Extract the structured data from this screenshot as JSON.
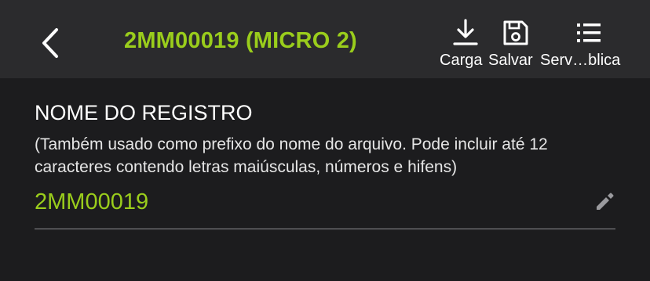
{
  "header": {
    "title": "2MM00019 (MICRO 2)",
    "back_icon": "chevron-left-icon",
    "actions": [
      {
        "label": "Carga",
        "icon": "download-icon"
      },
      {
        "label": "Salvar",
        "icon": "save-icon"
      },
      {
        "label": "Serv…blica",
        "icon": "list-icon"
      }
    ]
  },
  "field": {
    "title": "NOME DO REGISTRO",
    "help": "(Também usado como prefixo do nome do arquivo. Pode incluir até 12 caracteres contendo letras maiúsculas, números e hifens)",
    "value": "2MM00019",
    "edit_icon": "pencil-icon"
  },
  "colors": {
    "accent": "#9acd1c",
    "background": "#1c1c1e",
    "header_background": "#2b2b2d"
  }
}
